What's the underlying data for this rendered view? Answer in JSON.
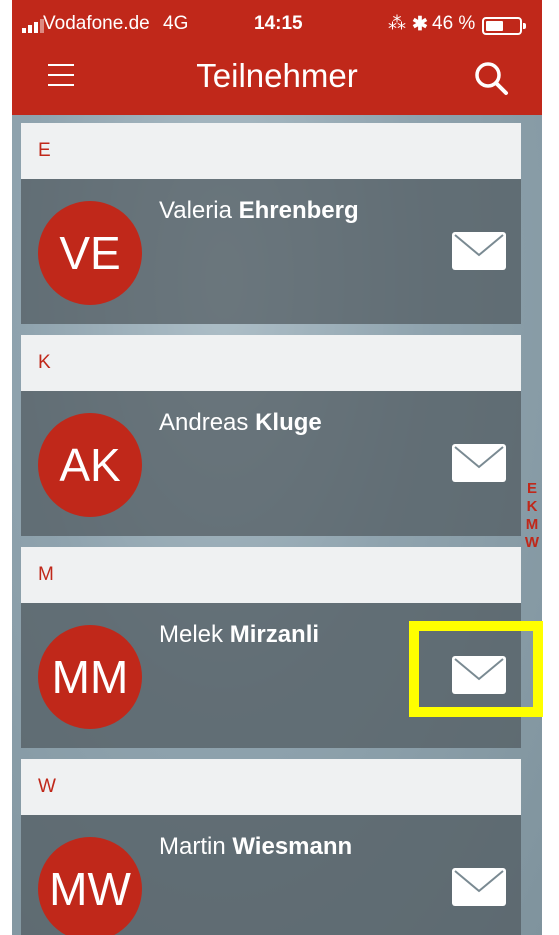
{
  "status_bar": {
    "carrier": "Vodafone.de",
    "network": "4G",
    "time": "14:15",
    "battery": "46 %"
  },
  "nav": {
    "title": "Teilnehmer",
    "menu_icon": "hamburger-menu-icon",
    "search_icon": "search-icon"
  },
  "sections": [
    {
      "letter": "E",
      "initials": "VE",
      "first": "Valeria",
      "last": "Ehrenberg"
    },
    {
      "letter": "K",
      "initials": "AK",
      "first": "Andreas",
      "last": "Kluge"
    },
    {
      "letter": "M",
      "initials": "MM",
      "first": "Melek",
      "last": "Mirzanli"
    },
    {
      "letter": "W",
      "initials": "MW",
      "first": "Martin",
      "last": "Wiesmann"
    }
  ],
  "index": [
    "E",
    "K",
    "M",
    "W"
  ],
  "colors": {
    "accent": "#c0281a",
    "highlight": "#ffff00"
  }
}
